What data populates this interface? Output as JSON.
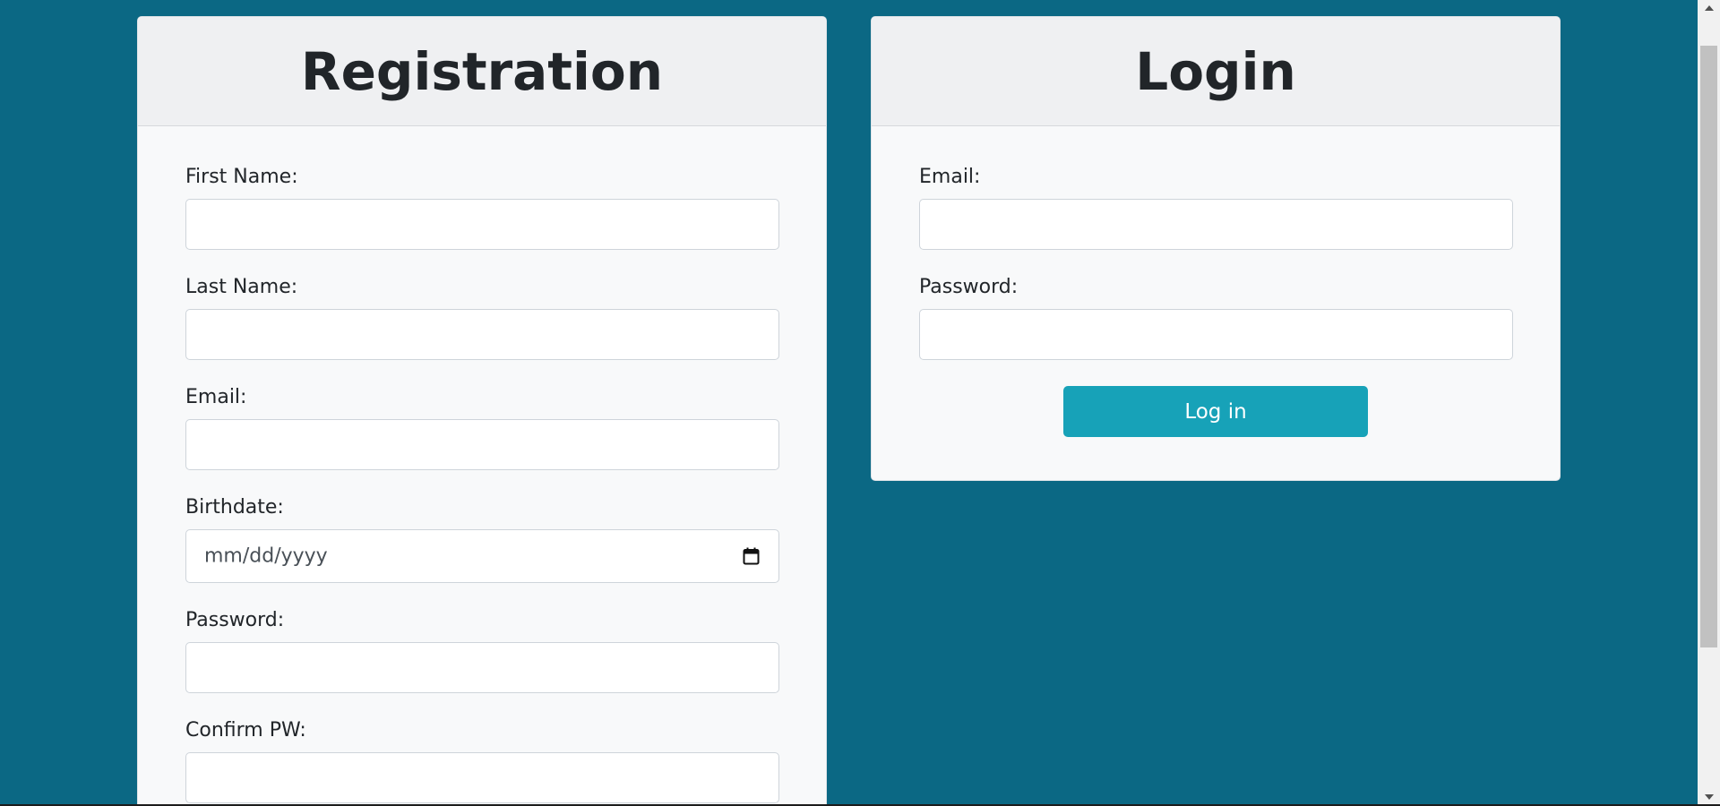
{
  "registration": {
    "title": "Registration",
    "fields": [
      {
        "label": "First Name:",
        "value": ""
      },
      {
        "label": "Last Name:",
        "value": ""
      },
      {
        "label": "Email:",
        "value": ""
      },
      {
        "label": "Birthdate:",
        "value": "mm/dd/yyyy"
      },
      {
        "label": "Password:",
        "value": ""
      },
      {
        "label": "Confirm PW:",
        "value": ""
      }
    ]
  },
  "login": {
    "title": "Login",
    "fields": [
      {
        "label": "Email:",
        "value": ""
      },
      {
        "label": "Password:",
        "value": ""
      }
    ],
    "button_label": "Log in"
  },
  "colors": {
    "background": "#0b6884",
    "button": "#17a2b8",
    "card": "#f8f9fa",
    "card_header": "#eff0f2"
  },
  "icons": {
    "calendar": "calendar-icon",
    "scroll_up": "chevron-up-icon",
    "scroll_down": "chevron-down-icon"
  }
}
